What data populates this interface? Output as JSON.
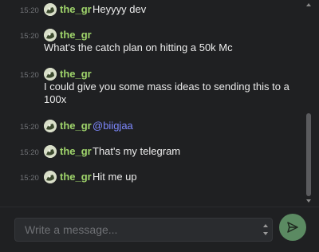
{
  "messages": [
    {
      "time": "15:20",
      "author": "the_gr",
      "text": "Heyyyy dev"
    },
    {
      "time": "15:20",
      "author": "the_gr",
      "text": "What's the catch plan on hitting a 50k Mc"
    },
    {
      "time": "15:20",
      "author": "the_gr",
      "text": "I could give you some mass ideas to sending this to a 100x"
    },
    {
      "time": "15:20",
      "author": "the_gr",
      "mention": "@biigjaa"
    },
    {
      "time": "15:20",
      "author": "the_gr",
      "text": "That's my telegram"
    },
    {
      "time": "15:20",
      "author": "the_gr",
      "text": "Hit me up"
    }
  ],
  "composer": {
    "placeholder": "Write a message..."
  },
  "icons": {
    "send": "send-icon",
    "avatar": "user-avatar"
  },
  "colors": {
    "username": "#9fd46b",
    "mention": "#7e89ff",
    "send_button": "#5b8a62",
    "background": "#1f2022"
  }
}
